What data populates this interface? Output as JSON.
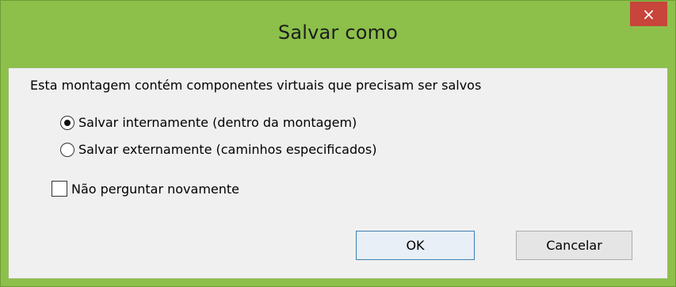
{
  "window": {
    "title": "Salvar como",
    "close_glyph": "×"
  },
  "dialog": {
    "message": "Esta montagem contém componentes virtuais que precisam ser salvos",
    "options": [
      {
        "label": "Salvar internamente (dentro da montagem)",
        "selected": true
      },
      {
        "label": "Salvar externamente (caminhos especificados)",
        "selected": false
      }
    ],
    "dont_ask_label": "Não perguntar novamente",
    "dont_ask_checked": false
  },
  "buttons": {
    "ok": "OK",
    "cancel": "Cancelar"
  },
  "colors": {
    "titlebar": "#8cc04a",
    "close_button": "#c7453a",
    "body": "#f0f0f0",
    "default_button_border": "#3c7fb1"
  },
  "icons": {
    "close": "close-icon"
  }
}
